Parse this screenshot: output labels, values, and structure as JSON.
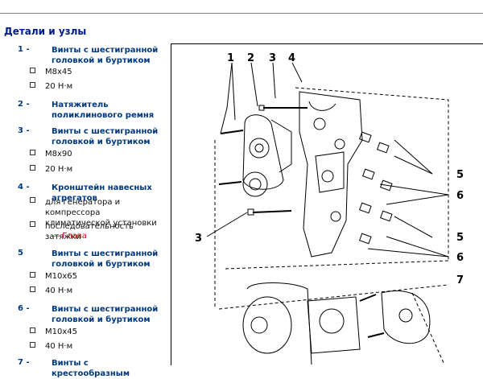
{
  "heading": "Детали и узлы",
  "items": [
    {
      "num": "1 -",
      "title": "Винты с шестигранной головкой и буртиком",
      "specs": [
        "M8x45",
        "20 Н·м"
      ]
    },
    {
      "num": "2 -",
      "title": "Натяжитель поликлинового ремня",
      "specs": []
    },
    {
      "num": "3 -",
      "title": "Винты с шестигранной головкой и буртиком",
      "specs": [
        "M8x90",
        "20 Н·м"
      ]
    },
    {
      "num": "4 -",
      "title": "Кронштейн навесных агрегатов",
      "specs": [
        "для генератора и компрессора климатической установки",
        "последовательность затяжки"
      ],
      "link": "— Глава"
    },
    {
      "num": "5",
      "title": "Винты с шестигранной головкой и буртиком",
      "specs": [
        "M10x65",
        "40 Н·м"
      ]
    },
    {
      "num": "6 -",
      "title": "Винты с шестигранной головкой и буртиком",
      "specs": [
        "M10x45",
        "40 Н·м"
      ]
    },
    {
      "num": "7 -",
      "title": "Винты с крестообразным"
    }
  ],
  "figure_labels": {
    "l1": "1",
    "l2": "2",
    "l3": "3",
    "l4": "4",
    "l3b": "3",
    "l5a": "5",
    "l6a": "6",
    "l5b": "5",
    "l6b": "6",
    "l7": "7"
  },
  "colors": {
    "heading": "#001a8c",
    "item_title": "#003880",
    "link": "#d01010"
  }
}
